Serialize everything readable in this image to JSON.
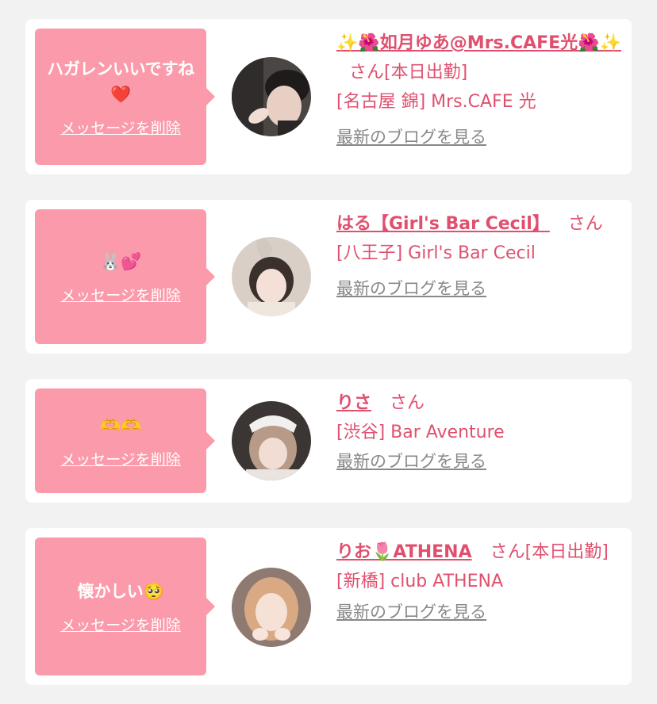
{
  "messages": [
    {
      "message": "ハガレンいいですね❤️",
      "delete_label": "メッセージを削除",
      "name": "✨🌺如月ゆあ@Mrs.CAFE光🌺✨",
      "honorific": "さん",
      "status": "[本日出勤]",
      "shop": "[名古屋 錦] Mrs.CAFE 光",
      "blog_link": "最新のブログを見る"
    },
    {
      "message": "🐰💕",
      "delete_label": "メッセージを削除",
      "name": "はる【Girl's Bar Cecil】",
      "honorific": "さん",
      "status": "",
      "shop": "[八王子] Girl's Bar Cecil",
      "blog_link": "最新のブログを見る"
    },
    {
      "message": "🫶🫶",
      "delete_label": "メッセージを削除",
      "name": "りさ",
      "honorific": "さん",
      "status": "",
      "shop": "[渋谷] Bar Aventure",
      "blog_link": "最新のブログを見る"
    },
    {
      "message": "懐かしい🥺",
      "delete_label": "メッセージを削除",
      "name": "りお🌷ATHENA",
      "honorific": "さん",
      "status": "[本日出勤]",
      "shop": "[新橋] club ATHENA",
      "blog_link": "最新のブログを見る"
    }
  ],
  "colors": {
    "background": "#f2f2f2",
    "card": "#ffffff",
    "bubble": "#fb9aaa",
    "accent": "#e0506e",
    "link_gray": "#888888"
  }
}
